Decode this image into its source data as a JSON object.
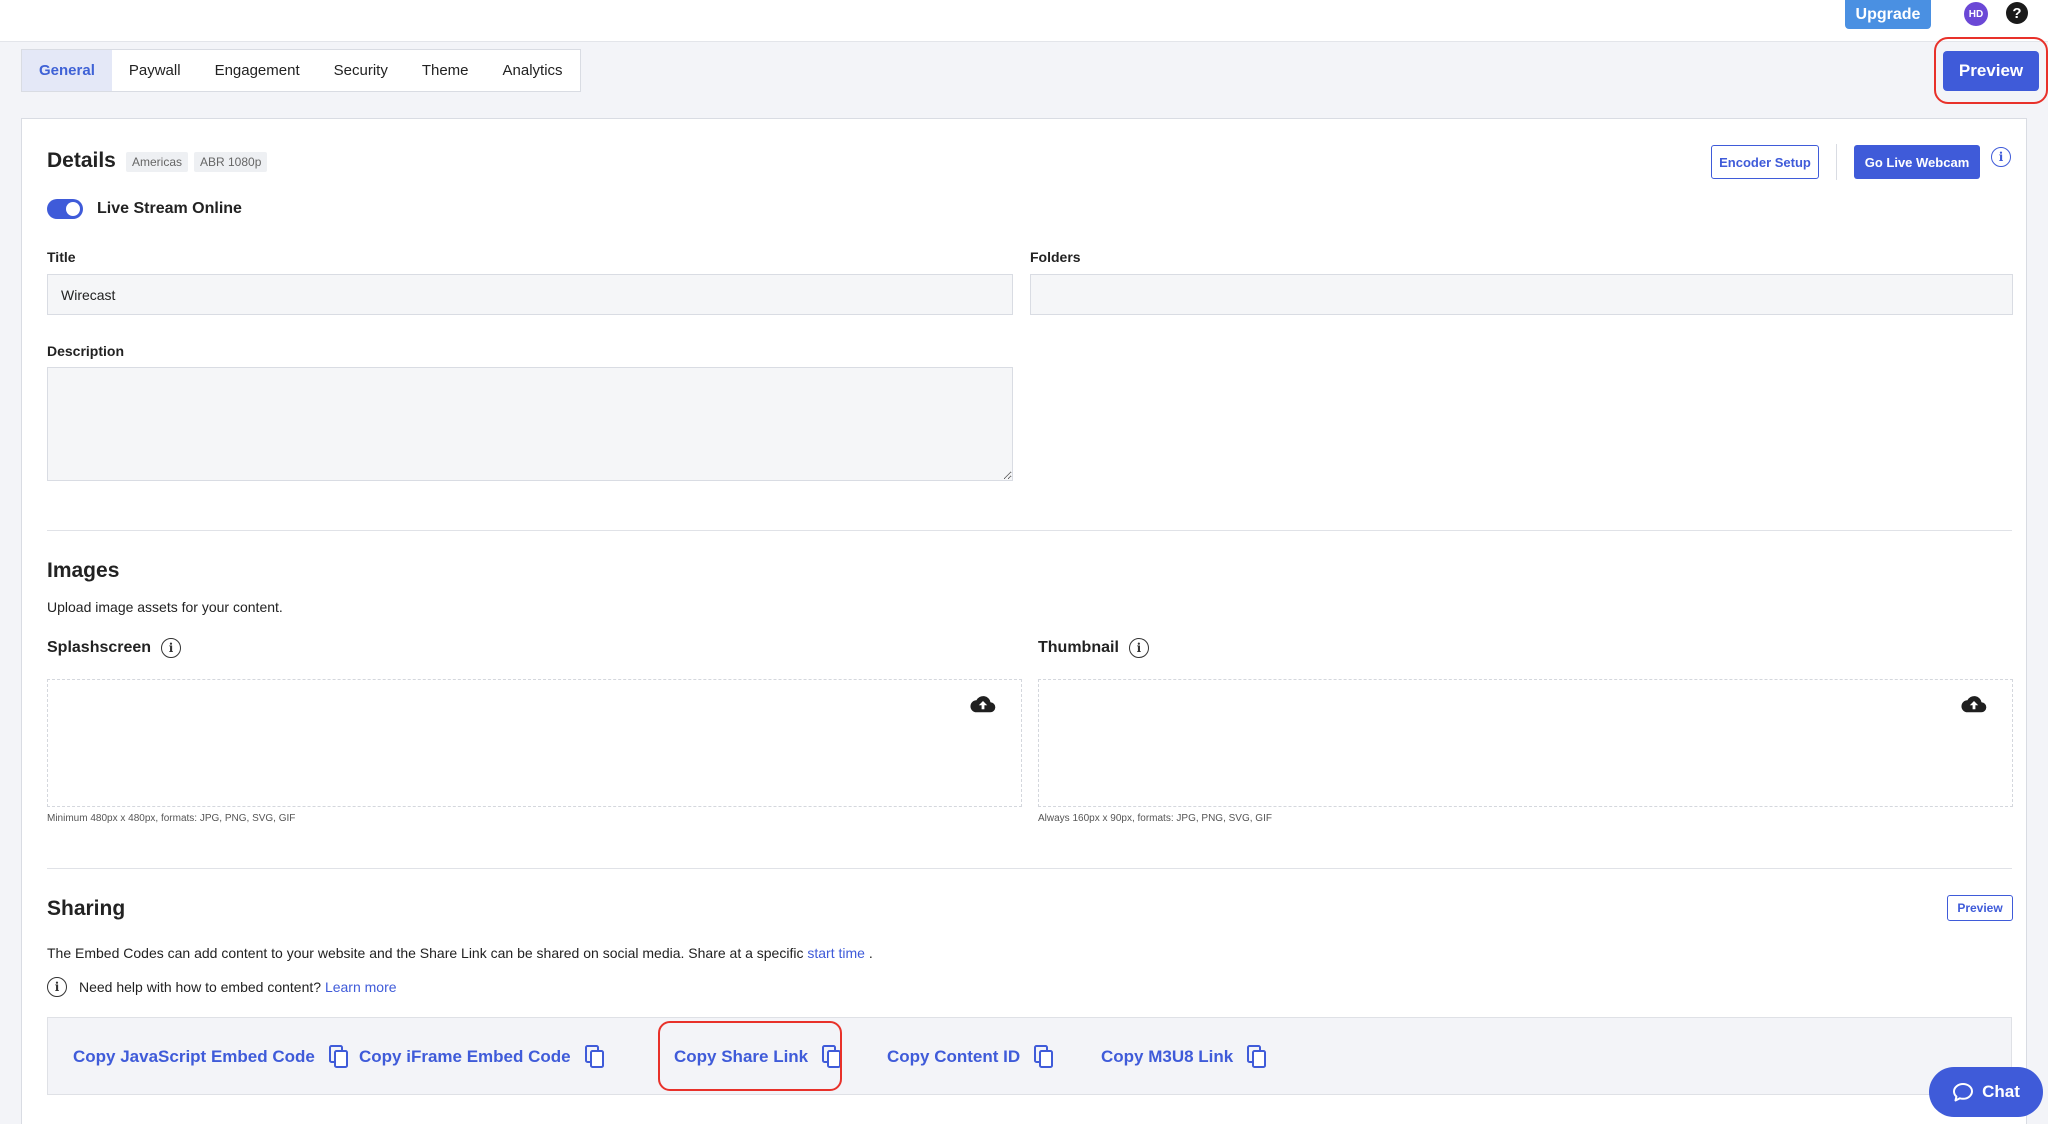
{
  "topbar": {
    "upgrade_label": "Upgrade",
    "avatar_initials": "HD",
    "help_glyph": "?"
  },
  "tabs": [
    {
      "label": "General",
      "active": true
    },
    {
      "label": "Paywall",
      "active": false
    },
    {
      "label": "Engagement",
      "active": false
    },
    {
      "label": "Security",
      "active": false
    },
    {
      "label": "Theme",
      "active": false
    },
    {
      "label": "Analytics",
      "active": false
    }
  ],
  "preview_label": "Preview",
  "details": {
    "heading": "Details",
    "badges": [
      "Americas",
      "ABR 1080p"
    ],
    "encoder_setup_label": "Encoder Setup",
    "go_live_label": "Go Live Webcam",
    "info_glyph": "i",
    "toggle_label": "Live Stream Online",
    "toggle_on": true,
    "title_label": "Title",
    "title_value": "Wirecast",
    "folders_label": "Folders",
    "folders_value": "",
    "description_label": "Description",
    "description_value": ""
  },
  "images": {
    "heading": "Images",
    "subtitle": "Upload image assets for your content.",
    "splash_label": "Splashscreen",
    "splash_hint": "Minimum 480px x 480px, formats: JPG, PNG, SVG, GIF",
    "thumb_label": "Thumbnail",
    "thumb_hint": "Always 160px x 90px, formats: JPG, PNG, SVG, GIF",
    "info_glyph": "i",
    "upload_icon": "cloud-upload-icon"
  },
  "sharing": {
    "heading": "Sharing",
    "preview_label": "Preview",
    "desc_prefix": "The Embed Codes can add content to your website and the Share Link can be shared on social media. Share at a specific ",
    "desc_link": "start time",
    "desc_suffix": " .",
    "help_text": "Need help with how to embed content?",
    "help_link": "Learn more",
    "info_glyph": "i",
    "copy_items": [
      "Copy JavaScript Embed Code",
      "Copy iFrame Embed Code",
      "Copy Share Link",
      "Copy Content ID",
      "Copy M3U8 Link"
    ]
  },
  "chat_label": "Chat",
  "colors": {
    "accent": "#3f5bd9",
    "upgrade": "#4a90e2",
    "highlight_ring": "#e8312a"
  }
}
